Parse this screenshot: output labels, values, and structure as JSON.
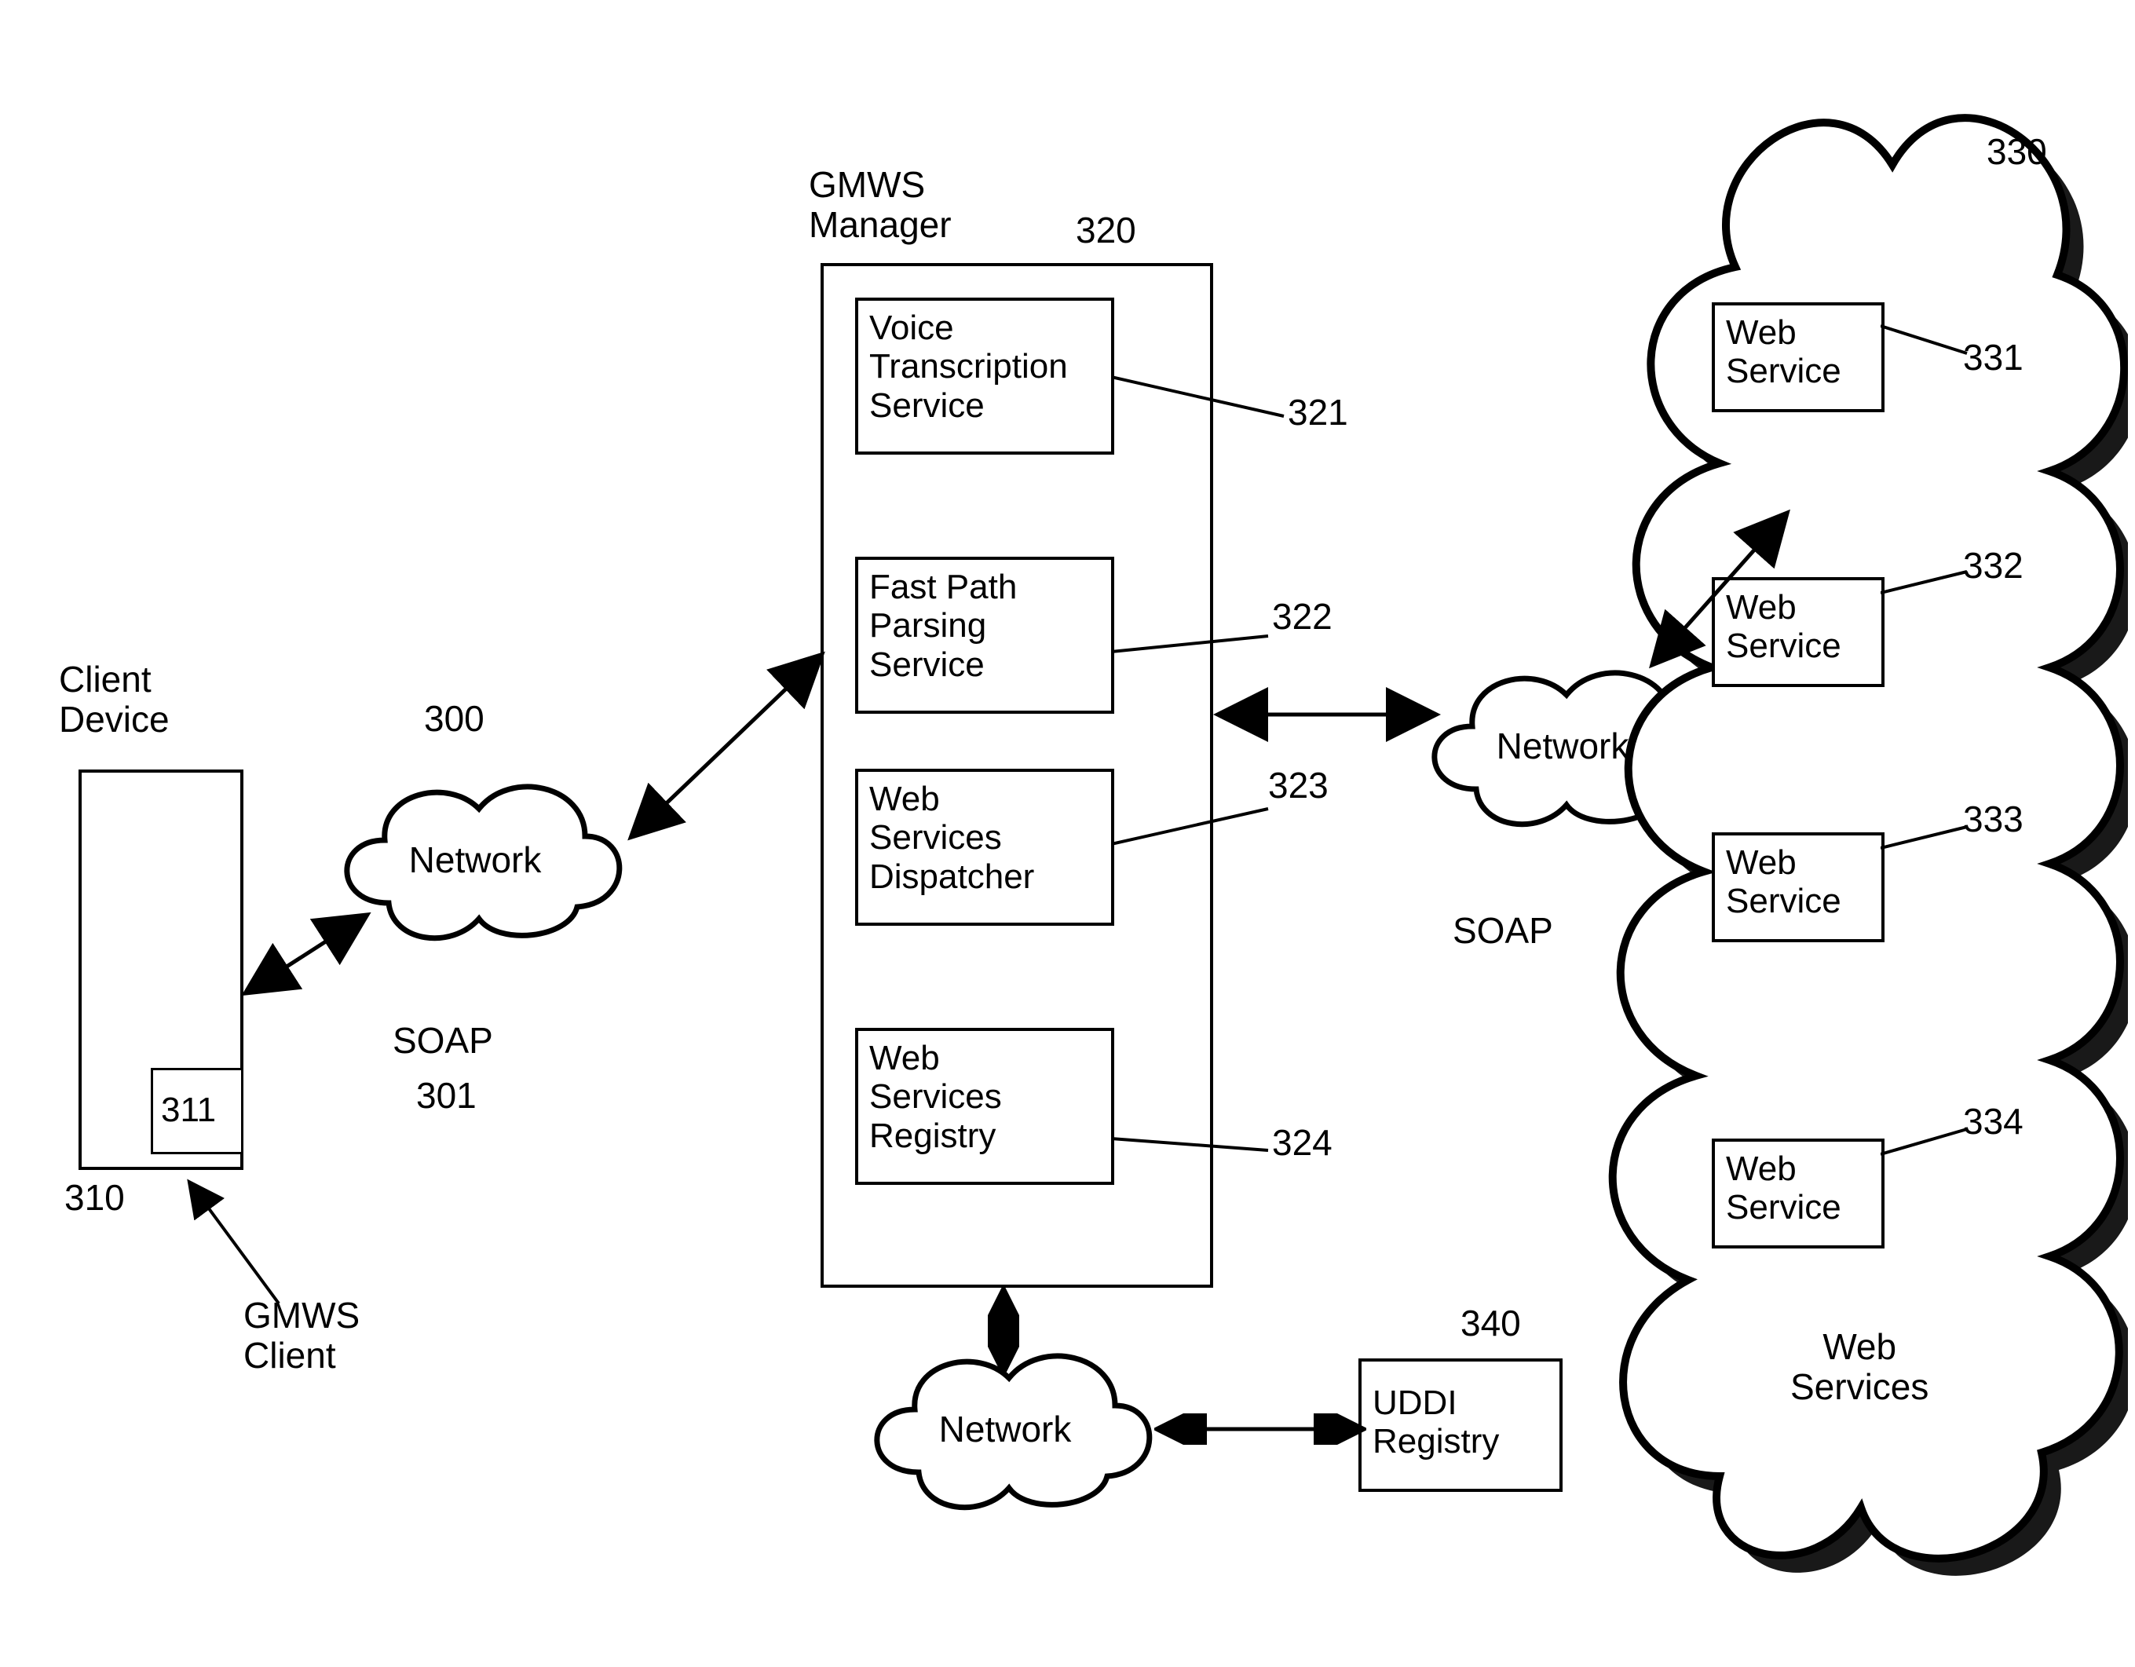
{
  "clientDevice": {
    "title": "Client\nDevice",
    "ref": "310",
    "inner": {
      "ref": "311",
      "label": "GMWS\nClient"
    }
  },
  "net1": {
    "label": "Network",
    "ref": "300",
    "proto": "SOAP",
    "protoRef": "301"
  },
  "manager": {
    "title": "GMWS\nManager",
    "ref": "320",
    "items": [
      {
        "label": "Voice\nTranscription\nService",
        "ref": "321"
      },
      {
        "label": "Fast Path\nParsing\nService",
        "ref": "322"
      },
      {
        "label": "Web\nServices\nDispatcher",
        "ref": "323"
      },
      {
        "label": "Web\nServices\nRegistry",
        "ref": "324"
      }
    ]
  },
  "net2": {
    "label": "Network",
    "proto": "SOAP"
  },
  "net3": {
    "label": "Network"
  },
  "uddi": {
    "label": "UDDI\nRegistry",
    "ref": "340"
  },
  "webServices": {
    "title": "Web\nServices",
    "ref": "330",
    "items": [
      {
        "label": "Web\nService",
        "ref": "331"
      },
      {
        "label": "Web\nService",
        "ref": "332"
      },
      {
        "label": "Web\nService",
        "ref": "333"
      },
      {
        "label": "Web\nService",
        "ref": "334"
      }
    ]
  }
}
